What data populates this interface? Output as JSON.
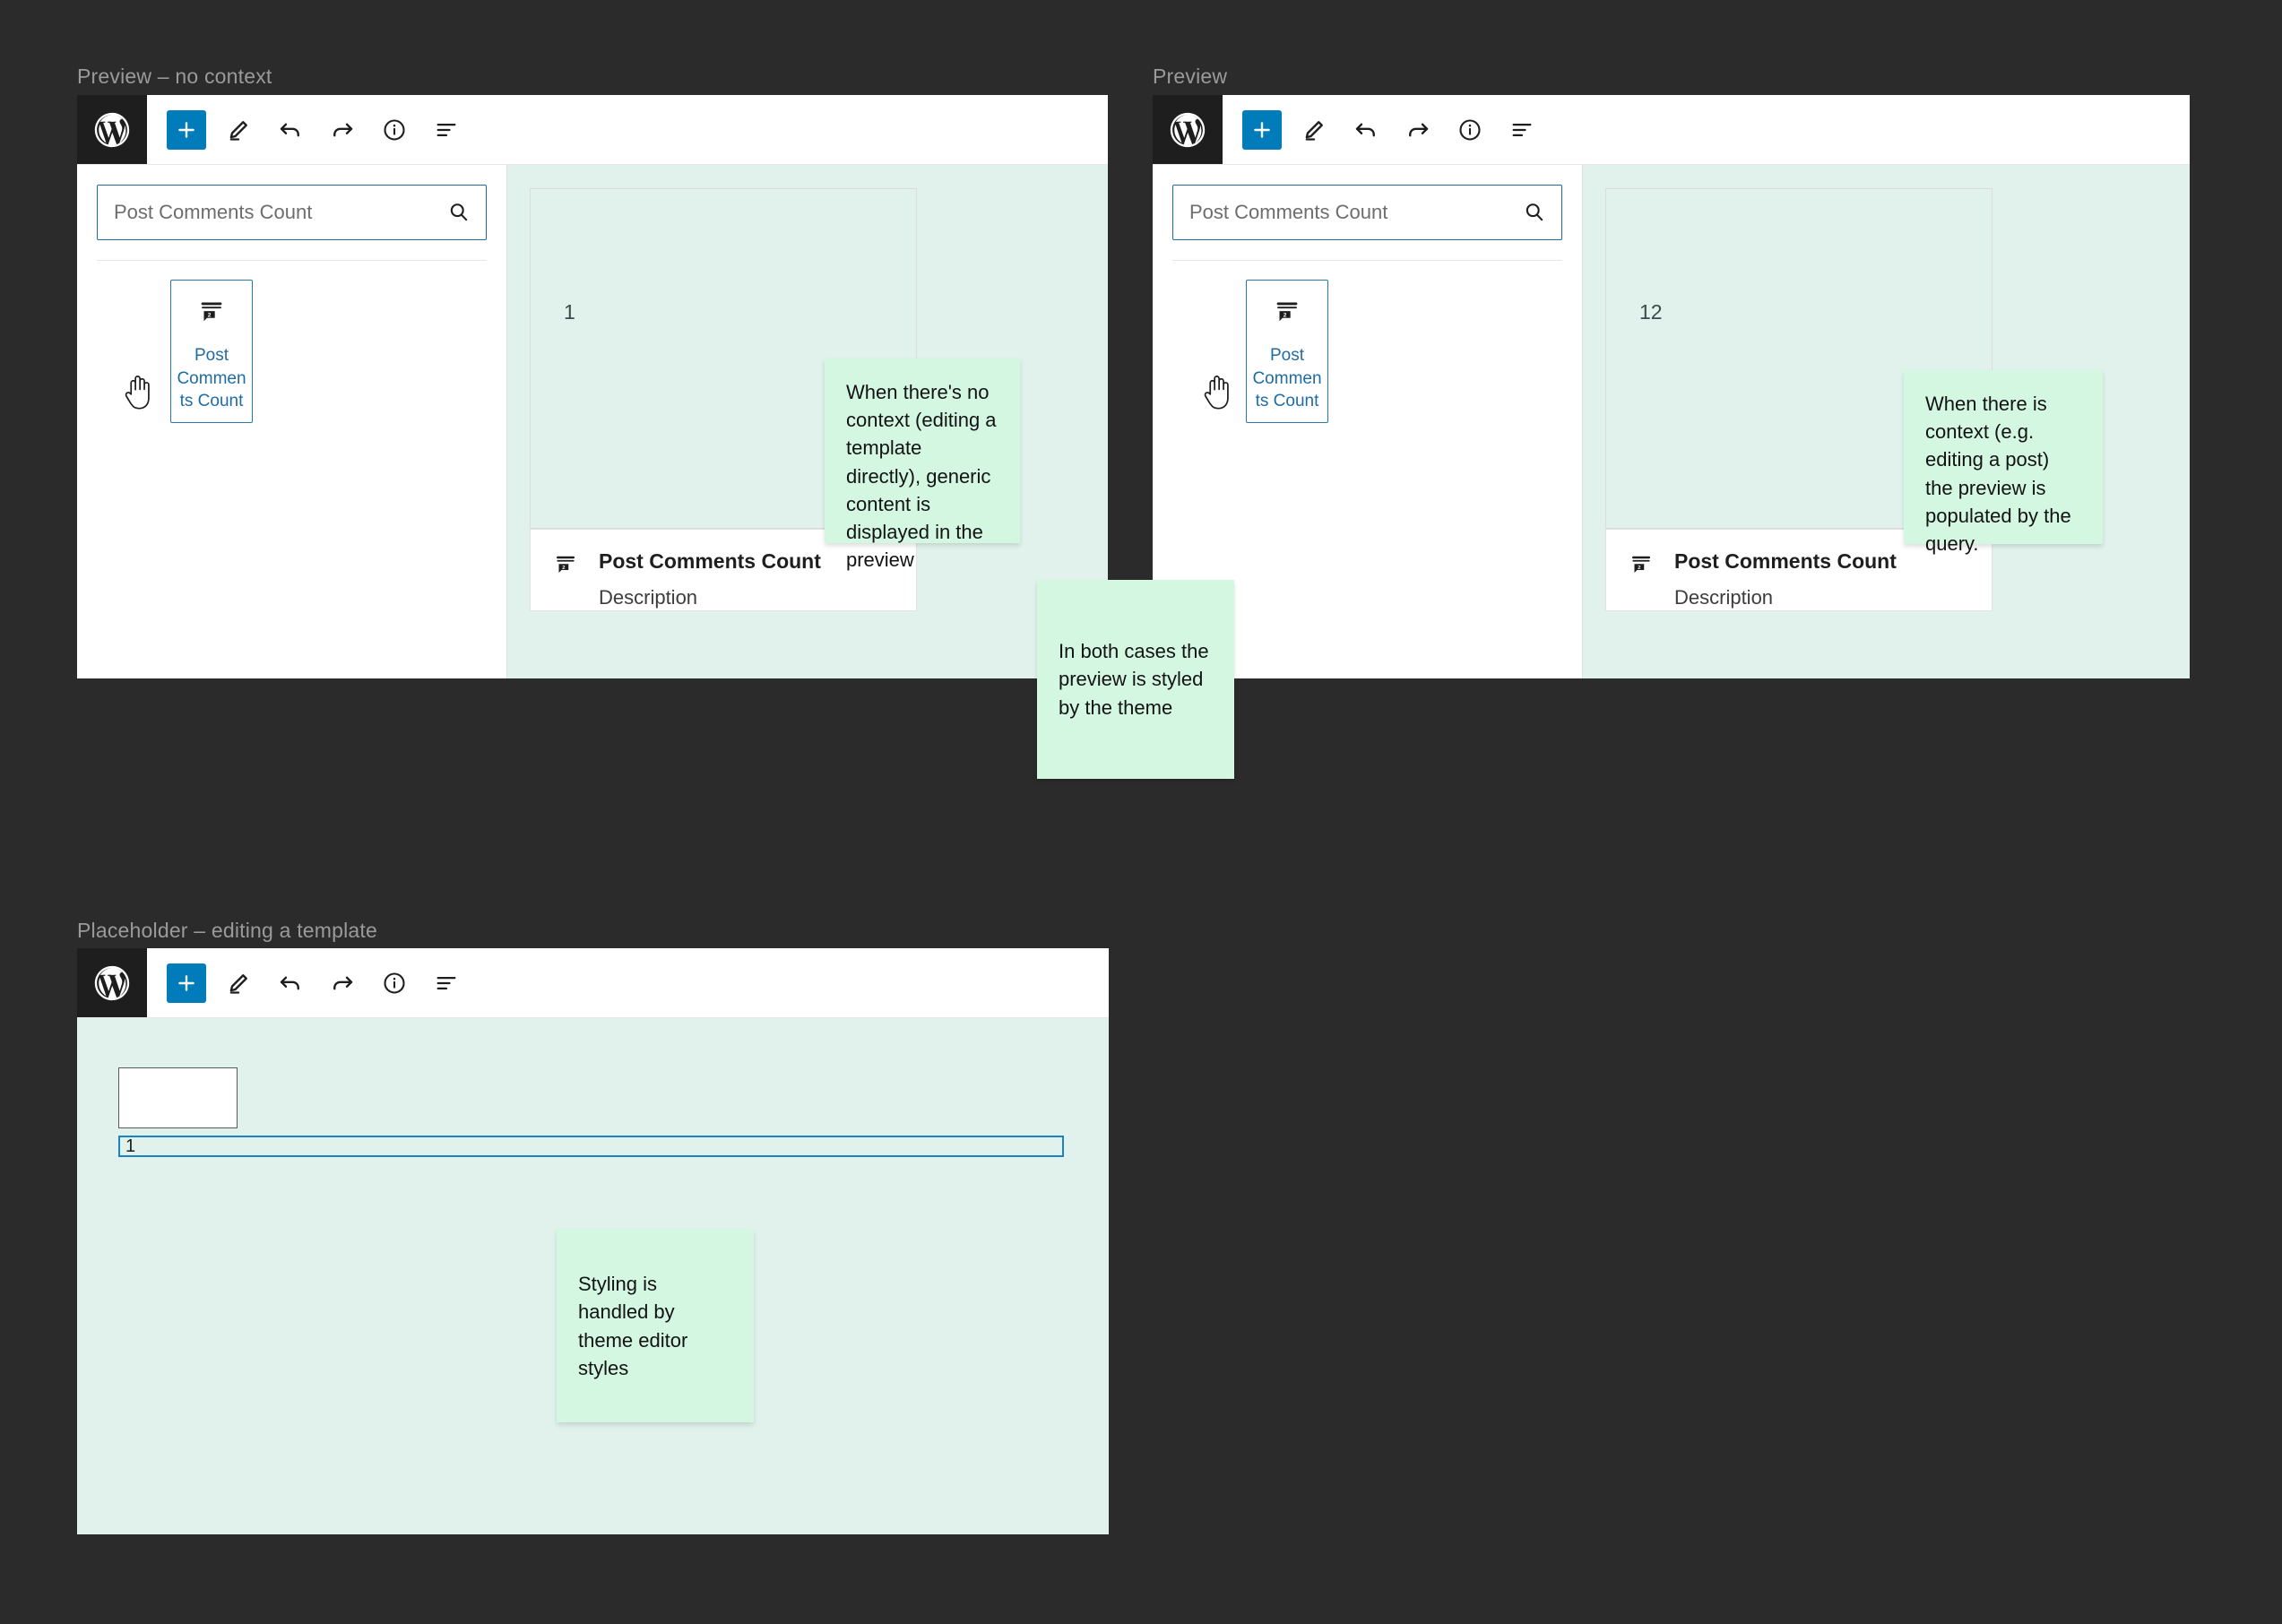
{
  "sections": {
    "preview_no_context": {
      "caption": "Preview – no context",
      "search_placeholder": "Post Comments Count",
      "block_label": "Post Comments Count",
      "preview_count": "1",
      "info_title": "Post Comments Count",
      "info_description": "Description"
    },
    "preview_with_context": {
      "caption": "Preview",
      "search_placeholder": "Post Comments Count",
      "block_label": "Post Comments Count",
      "preview_count": "12",
      "info_title": "Post Comments Count",
      "info_description": "Description"
    },
    "placeholder_template": {
      "caption": "Placeholder – editing a template",
      "field_value": "1"
    }
  },
  "notes": {
    "no_context": "When there's no context (editing a template directly), generic content is displayed in the preview",
    "with_context": "When there is context (e.g. editing a post) the preview is populated by the query.",
    "both_cases": "In both cases the preview is styled by the theme",
    "theme_styles": "Styling is handled by theme editor styles"
  },
  "toolbar": {
    "add_label": "+",
    "icons": [
      "wordpress-logo-icon",
      "add-block-icon",
      "edit-pencil-icon",
      "undo-icon",
      "redo-icon",
      "info-icon",
      "list-view-icon"
    ]
  },
  "colors": {
    "page_background": "#2b2b2b",
    "accent_blue": "#007cba",
    "block_card_border": "#2a7ab0",
    "block_label_blue": "#1e6ca3",
    "preview_background": "#e1f2ec",
    "sticky_note": "#d4f7e2",
    "logo_background": "#1e1e1e"
  }
}
